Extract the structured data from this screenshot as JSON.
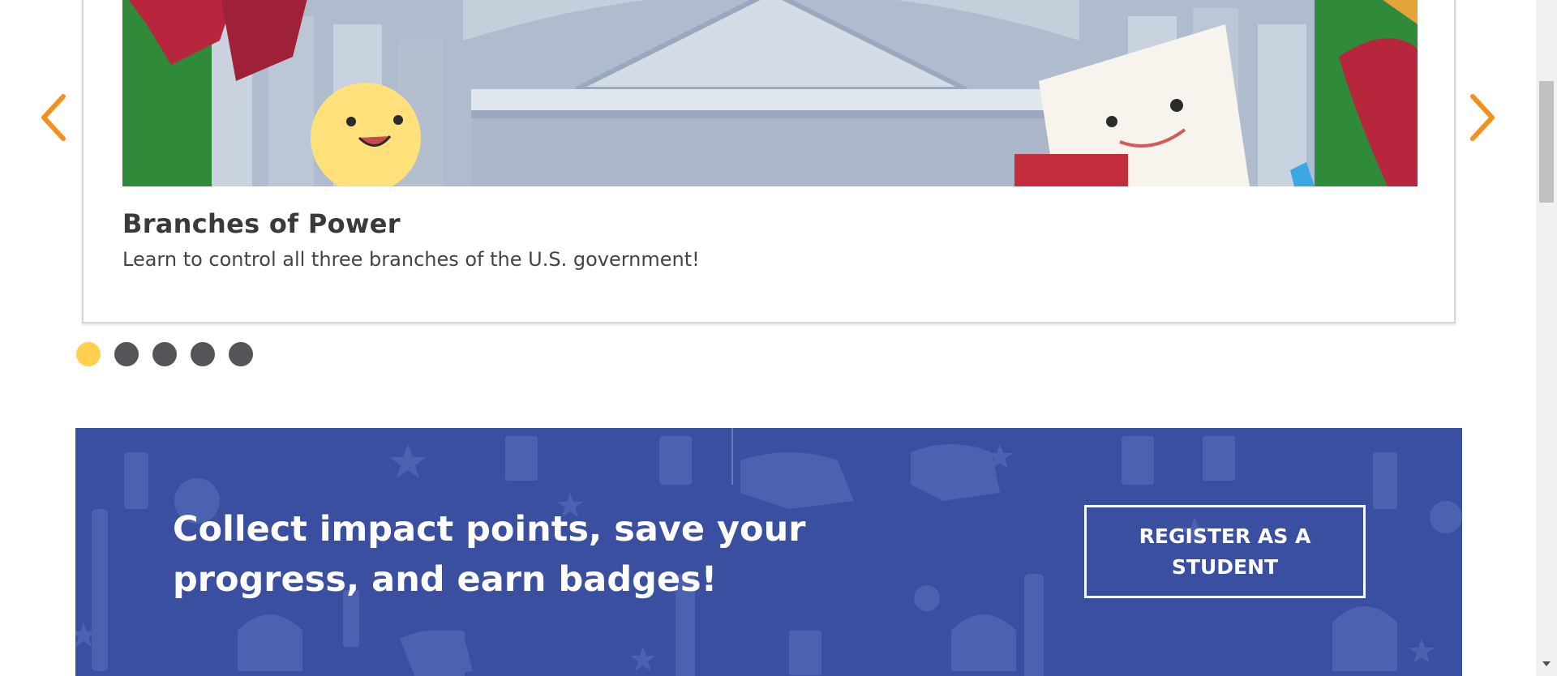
{
  "carousel": {
    "prev_icon": "chevron-left-icon",
    "next_icon": "chevron-right-icon",
    "arrow_color": "#f5901e",
    "slide": {
      "title": "Branches of Power",
      "description": "Learn to control all three branches of the U.S. government!"
    },
    "dots": {
      "count": 5,
      "active_index": 0,
      "active_color": "#ffcf4d",
      "inactive_color": "#555559"
    }
  },
  "banner": {
    "background_color": "#3a4fa0",
    "headline": "Collect impact points, save your progress, and earn badges!",
    "register_label": "REGISTER AS A STUDENT"
  }
}
